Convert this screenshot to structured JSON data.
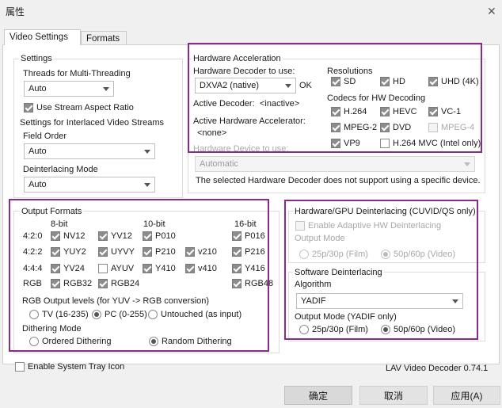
{
  "window": {
    "title": "属性"
  },
  "tabs": [
    {
      "label": "Video Settings",
      "active": true
    },
    {
      "label": "Formats",
      "active": false
    }
  ],
  "settings": {
    "group_label": "Settings",
    "threads_label": "Threads for Multi-Threading",
    "threads_value": "Auto",
    "stream_aspect_label": "Use Stream Aspect Ratio",
    "stream_aspect_checked": true,
    "interlaced_label": "Settings for Interlaced Video Streams",
    "field_order_label": "Field Order",
    "field_order_value": "Auto",
    "deinterlacing_mode_label": "Deinterlacing Mode",
    "deinterlacing_mode_value": "Auto"
  },
  "hw_accel": {
    "group_label": "Hardware Acceleration",
    "decoder_label": "Hardware Decoder to use:",
    "decoder_value": "DXVA2 (native)",
    "decoder_status": "OK",
    "active_decoder_label": "Active Decoder:",
    "active_decoder_value": "<inactive>",
    "active_accel_label": "Active Hardware Accelerator:",
    "active_accel_value": "<none>",
    "resolutions_label": "Resolutions",
    "resolutions": [
      {
        "label": "SD",
        "checked": true
      },
      {
        "label": "HD",
        "checked": true
      },
      {
        "label": "UHD (4K)",
        "checked": true
      }
    ],
    "codecs_label": "Codecs for HW Decoding",
    "codecs": [
      {
        "label": "H.264",
        "checked": true,
        "disabled": false
      },
      {
        "label": "HEVC",
        "checked": true,
        "disabled": false
      },
      {
        "label": "VC-1",
        "checked": true,
        "disabled": false
      },
      {
        "label": "MPEG-2",
        "checked": true,
        "disabled": false
      },
      {
        "label": "DVD",
        "checked": true,
        "disabled": false
      },
      {
        "label": "MPEG-4",
        "checked": false,
        "disabled": true
      },
      {
        "label": "VP9",
        "checked": true,
        "disabled": false
      },
      {
        "label": "H.264 MVC (Intel only)",
        "checked": false,
        "disabled": false
      }
    ],
    "device_label": "Hardware Device to use:",
    "device_value": "Automatic",
    "device_note": "The selected Hardware Decoder does not support using a specific device."
  },
  "output_formats": {
    "group_label": "Output Formats",
    "headers": [
      "8-bit",
      "10-bit",
      "16-bit"
    ],
    "rows": [
      {
        "label": "4:2:0",
        "items": [
          {
            "label": "NV12",
            "checked": true
          },
          {
            "label": "YV12",
            "checked": true
          },
          {
            "label": "P010",
            "checked": true
          },
          {
            "label": "P016",
            "checked": true
          }
        ]
      },
      {
        "label": "4:2:2",
        "items": [
          {
            "label": "YUY2",
            "checked": true
          },
          {
            "label": "UYVY",
            "checked": true
          },
          {
            "label": "P210",
            "checked": true
          },
          {
            "label": "v210",
            "checked": true
          },
          {
            "label": "P216",
            "checked": true
          }
        ]
      },
      {
        "label": "4:4:4",
        "items": [
          {
            "label": "YV24",
            "checked": true
          },
          {
            "label": "AYUV",
            "checked": false
          },
          {
            "label": "Y410",
            "checked": true
          },
          {
            "label": "v410",
            "checked": true
          },
          {
            "label": "Y416",
            "checked": true
          }
        ]
      },
      {
        "label": "RGB",
        "items": [
          {
            "label": "RGB32",
            "checked": true
          },
          {
            "label": "RGB24",
            "checked": true
          },
          {
            "label": "RGB48",
            "checked": true
          }
        ]
      }
    ],
    "rgb_levels_label": "RGB Output levels (for YUV -> RGB conversion)",
    "rgb_levels": [
      {
        "label": "TV (16-235)",
        "selected": false
      },
      {
        "label": "PC (0-255)",
        "selected": true
      },
      {
        "label": "Untouched (as input)",
        "selected": false
      }
    ],
    "dithering_label": "Dithering Mode",
    "dithering": [
      {
        "label": "Ordered Dithering",
        "selected": false
      },
      {
        "label": "Random Dithering",
        "selected": true
      }
    ]
  },
  "hw_deint": {
    "group_label": "Hardware/GPU Deinterlacing (CUVID/QS only)",
    "adaptive_label": "Enable Adaptive HW Deinterlacing",
    "output_mode_label": "Output Mode",
    "modes": [
      {
        "label": "25p/30p (Film)",
        "selected": false
      },
      {
        "label": "50p/60p (Video)",
        "selected": true
      }
    ]
  },
  "sw_deint": {
    "group_label": "Software Deinterlacing",
    "algorithm_label": "Algorithm",
    "algorithm_value": "YADIF",
    "output_mode_label": "Output Mode (YADIF only)",
    "modes": [
      {
        "label": "25p/30p (Film)",
        "selected": false
      },
      {
        "label": "50p/60p (Video)",
        "selected": true
      }
    ]
  },
  "footer": {
    "tray_label": "Enable System Tray Icon",
    "version": "LAV Video Decoder 0.74.1"
  },
  "buttons": {
    "ok": "确定",
    "cancel": "取消",
    "apply": "应用(A)"
  },
  "colors": {
    "highlight": "#8b2a8b",
    "checkbox_checked": "#8c8c8c"
  }
}
